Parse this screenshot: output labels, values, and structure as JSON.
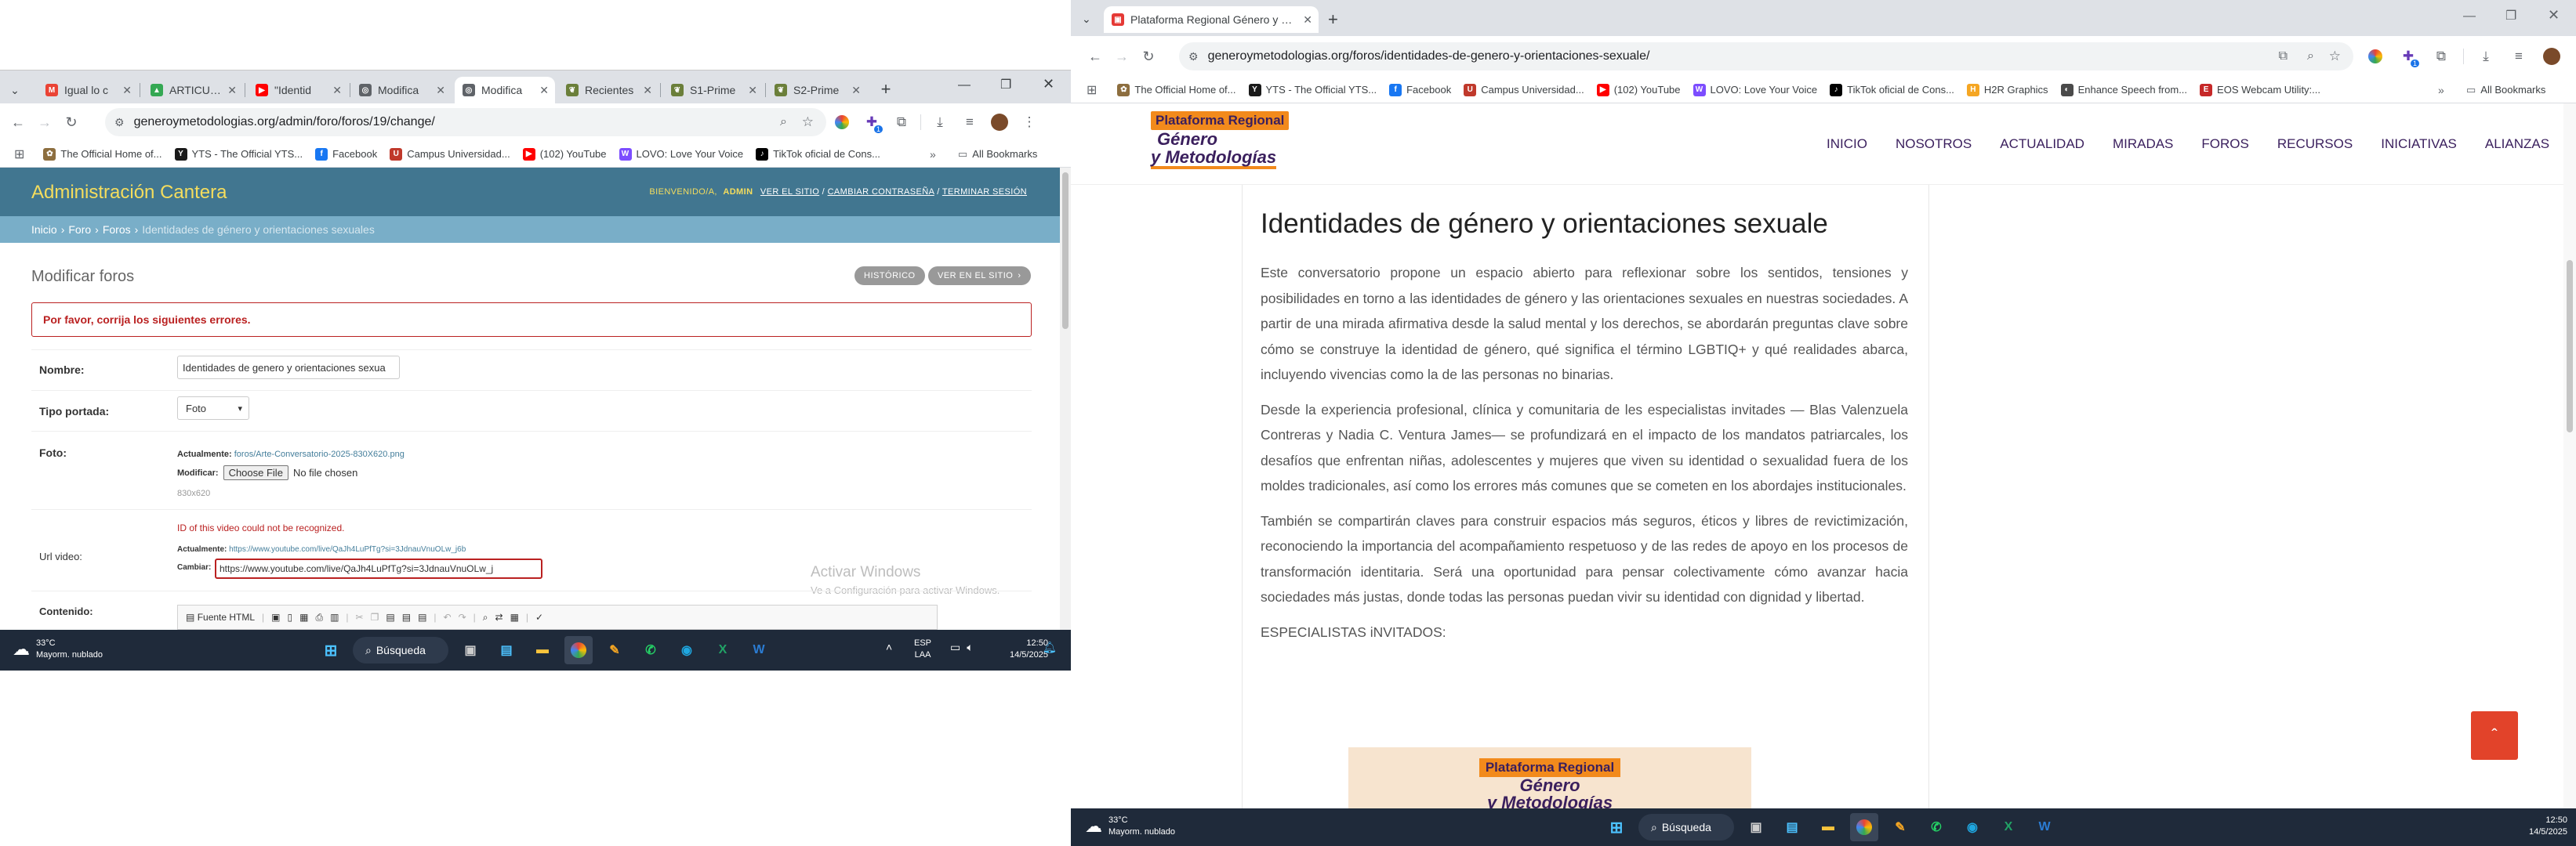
{
  "left_screen": {
    "browser": {
      "tabs": [
        {
          "label": "Igual lo c",
          "fav_color": "#ea4335",
          "fav_glyph": "M"
        },
        {
          "label": "ARTICULO",
          "fav_color": "#34a853",
          "fav_glyph": "▲"
        },
        {
          "label": "\"Identid",
          "fav_color": "#ff0000",
          "fav_glyph": "▶"
        },
        {
          "label": "Modifica",
          "fav_color": "#5f6368",
          "fav_glyph": "◎"
        },
        {
          "label": "Modifica",
          "fav_color": "#5f6368",
          "fav_glyph": "◎"
        },
        {
          "label": "Recientes",
          "fav_color": "#6b7f3a",
          "fav_glyph": "❦"
        },
        {
          "label": "S1-Prime",
          "fav_color": "#6b7f3a",
          "fav_glyph": "❦"
        },
        {
          "label": "S2-Prime",
          "fav_color": "#6b7f3a",
          "fav_glyph": "❦"
        }
      ],
      "new_tab": "+",
      "url": "generoymetodologias.org/admin/foro/foros/19/change/",
      "extension_badge": "1",
      "bookmarks": [
        {
          "label": "The Official Home of...",
          "color": "#8d6e3f",
          "glyph": "✿"
        },
        {
          "label": "YTS - The Official YTS...",
          "color": "#1a1a1a",
          "glyph": "Y"
        },
        {
          "label": "Facebook",
          "color": "#1877f2",
          "glyph": "f"
        },
        {
          "label": "Campus Universidad...",
          "color": "#c0392b",
          "glyph": "U"
        },
        {
          "label": "(102) YouTube",
          "color": "#ff0000",
          "glyph": "▶"
        },
        {
          "label": "LOVO: Love Your Voice",
          "color": "#7c4dff",
          "glyph": "W"
        },
        {
          "label": "TikTok oficial de Cons...",
          "color": "#000000",
          "glyph": "♪"
        }
      ],
      "all_bookmarks": "All Bookmarks"
    },
    "admin": {
      "site_name": "Administración Cantera",
      "welcome": "BIENVENIDO/A,",
      "user": "ADMIN",
      "user_links": [
        "VER EL SITIO",
        "CAMBIAR CONTRASEÑA",
        "TERMINAR SESIÓN"
      ],
      "breadcrumbs": [
        "Inicio",
        "Foro",
        "Foros"
      ],
      "breadcrumb_current": "Identidades de género y orientaciones sexuales",
      "page_title": "Modificar foros",
      "history_btn": "HISTÓRICO",
      "view_site_btn": "VER EN EL SITIO",
      "error_note": "Por favor, corrija los siguientes errores.",
      "fields": {
        "nombre_label": "Nombre:",
        "nombre_value": "Identidades de genero y orientaciones sexua",
        "tipo_label": "Tipo portada:",
        "tipo_value": "Foto",
        "foto_label": "Foto:",
        "foto_current_label": "Actualmente:",
        "foto_current_link": "foros/Arte-Conversatorio-2025-830X620.png",
        "foto_modify_label": "Modificar:",
        "choose_file": "Choose File",
        "no_file": "No file chosen",
        "foto_hint": "830x620",
        "video_error": "ID of this video could not be recognized.",
        "url_label": "Url video:",
        "url_current_label": "Actualmente:",
        "url_current_link": "https://www.youtube.com/live/QaJh4LuPfTg?si=3JdnauVnuOLw_j6b",
        "url_change_label": "Cambiar:",
        "url_change_value": "https://www.youtube.com/live/QaJh4LuPfTg?si=3JdnauVnuOLw_j",
        "contenido_label": "Contenido:",
        "editor_source": "Fuente HTML"
      },
      "activate_title": "Activar Windows",
      "activate_sub": "Ve a Configuración para activar Windows."
    },
    "taskbar": {
      "temp": "33°C",
      "weather": "Mayorm. nublado",
      "search": "Búsqueda",
      "lang1": "ESP",
      "lang2": "LAA",
      "time": "12:50",
      "date": "14/5/2025"
    }
  },
  "right_screen": {
    "browser": {
      "tab_label": "Plataforma Regional Género y Met",
      "new_tab": "+",
      "url": "generoymetodologias.org/foros/identidades-de-genero-y-orientaciones-sexuale/",
      "extension_badge": "1",
      "bookmarks": [
        {
          "label": "The Official Home of...",
          "color": "#8d6e3f",
          "glyph": "✿"
        },
        {
          "label": "YTS - The Official YTS...",
          "color": "#1a1a1a",
          "glyph": "Y"
        },
        {
          "label": "Facebook",
          "color": "#1877f2",
          "glyph": "f"
        },
        {
          "label": "Campus Universidad...",
          "color": "#c0392b",
          "glyph": "U"
        },
        {
          "label": "(102) YouTube",
          "color": "#ff0000",
          "glyph": "▶"
        },
        {
          "label": "LOVO: Love Your Voice",
          "color": "#7c4dff",
          "glyph": "W"
        },
        {
          "label": "TikTok oficial de Cons...",
          "color": "#000000",
          "glyph": "♪"
        },
        {
          "label": "H2R Graphics",
          "color": "#f5a623",
          "glyph": "H"
        },
        {
          "label": "Enhance Speech from...",
          "color": "#4a4a4a",
          "glyph": "◐"
        },
        {
          "label": "EOS Webcam Utility:...",
          "color": "#c62828",
          "glyph": "E"
        }
      ],
      "all_bookmarks": "All Bookmarks"
    },
    "site": {
      "logo_line1": "Plataforma Regional",
      "logo_line2": "Género",
      "logo_line3": "y Metodologías",
      "nav": [
        "INICIO",
        "NOSOTROS",
        "ACTUALIDAD",
        "MIRADAS",
        "FOROS",
        "RECURSOS",
        "INICIATIVAS",
        "ALIANZAS"
      ],
      "article_title": "Identidades de género y orientaciones sexuale",
      "paragraphs": [
        "Este conversatorio propone un espacio abierto para reflexionar sobre los sentidos, tensiones y posibilidades en torno a las identidades de género y las orientaciones sexuales en nuestras sociedades. A partir de una mirada afirmativa desde la salud mental y los derechos, se abordarán preguntas clave sobre cómo se construye la identidad de género, qué significa el término LGBTIQ+ y qué realidades abarca, incluyendo vivencias como la de las personas no binarias.",
        "Desde la experiencia profesional, clínica y comunitaria de les especialistas invitades — Blas Valenzuela Contreras y Nadia C. Ventura James— se profundizará en el impacto de los mandatos patriarcales, los desafíos que enfrentan niñas, adolescentes y mujeres que viven su identidad o sexualidad fuera de los moldes tradicionales, así como los errores más comunes que se cometen en los abordajes institucionales.",
        "También se compartirán claves para construir espacios más seguros, éticos y libres de revictimización, reconociendo la importancia del acompañamiento respetuoso y de las redes de apoyo en los procesos de transformación identitaria. Será una oportunidad para pensar colectivamente cómo avanzar hacia sociedades más justas, donde todas las personas puedan vivir su identidad con dignidad y libertad."
      ],
      "specialists": "ESPECIALISTAS iNVITADOS:",
      "image_line1": "Plataforma Regional",
      "image_line2": "Género",
      "image_line3": "y Metodologías",
      "scroll_top": "ˆ"
    },
    "taskbar": {
      "temp": "33°C",
      "weather": "Mayorm. nublado",
      "search": "Búsqueda",
      "time": "12:50",
      "date": "14/5/2025"
    }
  },
  "colors": {
    "admin_header": "#417690",
    "admin_breadcrumb": "#79aec8",
    "admin_title_yellow": "#f5dd5d",
    "error_red": "#ba2121",
    "site_orange": "#f28a1c",
    "scroll_btn": "#e2432a",
    "taskbar": "#1f2a3a"
  }
}
